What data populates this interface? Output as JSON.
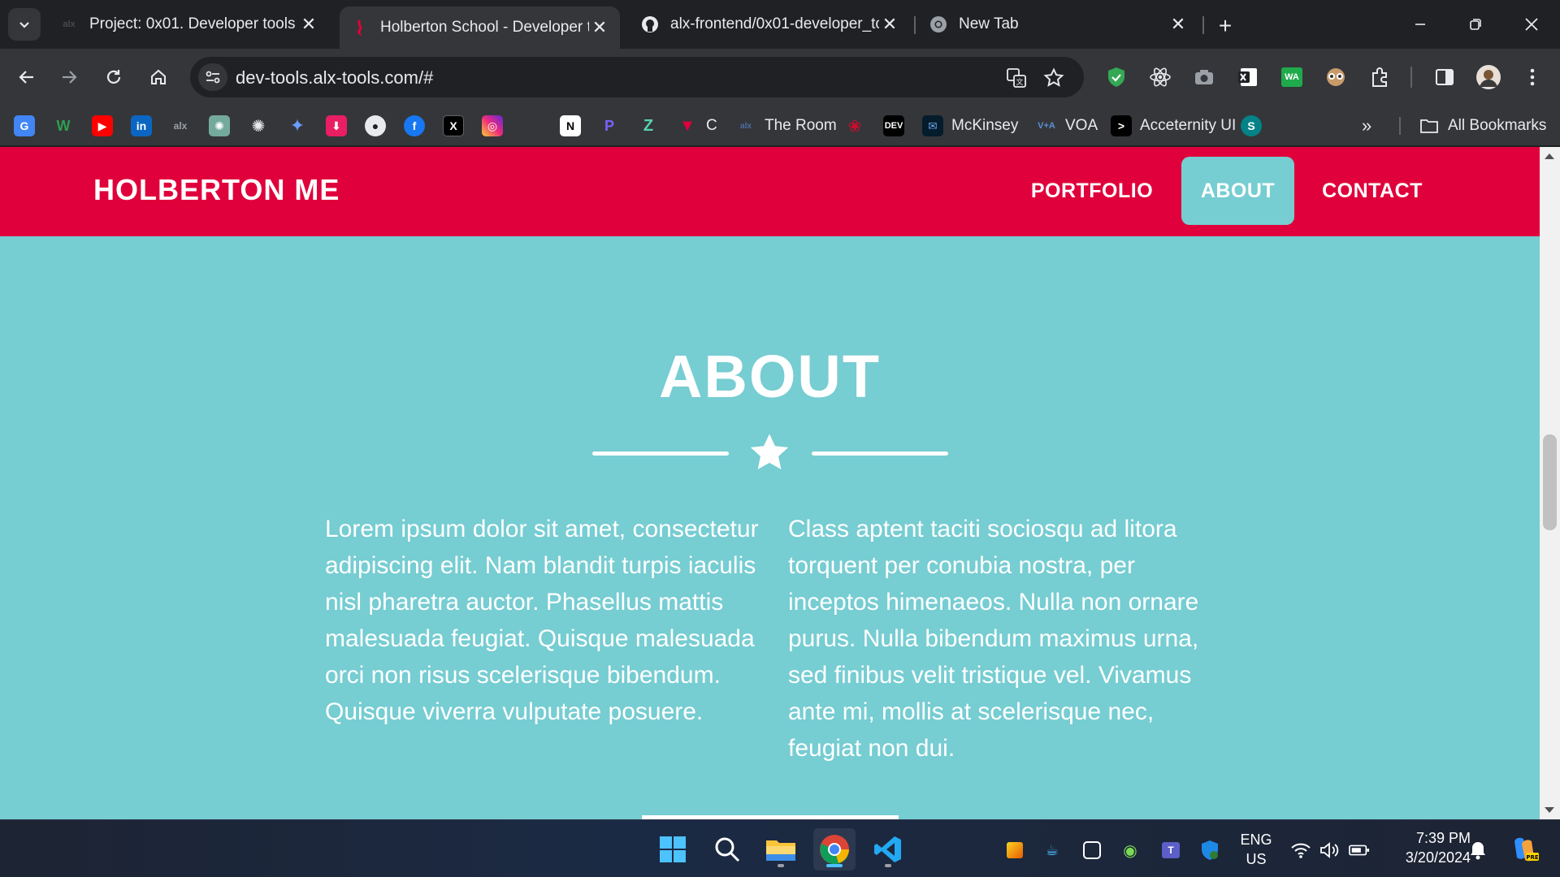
{
  "tabs": [
    {
      "title": "Project: 0x01. Developer tools |",
      "favicon": "alx-icon",
      "active": false
    },
    {
      "title": "Holberton School - Developer t",
      "favicon": "holberton-icon",
      "active": true
    },
    {
      "title": "alx-frontend/0x01-developer_to",
      "favicon": "github-icon",
      "active": false
    },
    {
      "title": "New Tab",
      "favicon": "chrome-icon",
      "active": false
    }
  ],
  "toolbar": {
    "url": "dev-tools.alx-tools.com/#"
  },
  "bookmarks": {
    "the_room": "The Room",
    "c_label": "C",
    "mckinsey": "McKinsey",
    "voa": "VOA",
    "aceternity": "Acceternity UI",
    "dev": "DEV",
    "all_bookmarks": "All Bookmarks"
  },
  "site": {
    "brand": "HOLBERTON ME",
    "nav": [
      "PORTFOLIO",
      "ABOUT",
      "CONTACT"
    ],
    "active_nav": "ABOUT",
    "section_title": "ABOUT",
    "paragraph_left": "Lorem ipsum dolor sit amet, consectetur adipiscing elit. Nam blandit turpis iaculis nisl pharetra auctor. Phasellus mattis malesuada feugiat. Quisque malesuada orci non risus scelerisque bibendum. Quisque viverra vulputate posuere.",
    "paragraph_right": "Class aptent taciti sociosqu ad litora torquent per conubia nostra, per inceptos himenaeos. Nulla non ornare purus. Nulla bibendum maximus urna, sed finibus velit tristique vel. Vivamus ante mi, mollis at scelerisque nec, feugiat non dui.",
    "colors": {
      "navbar": "#e0003b",
      "background": "#76cdd2",
      "text": "#ffffff"
    }
  },
  "taskbar": {
    "lang_top": "ENG",
    "lang_bottom": "US",
    "time": "7:39 PM",
    "date": "3/20/2024"
  }
}
